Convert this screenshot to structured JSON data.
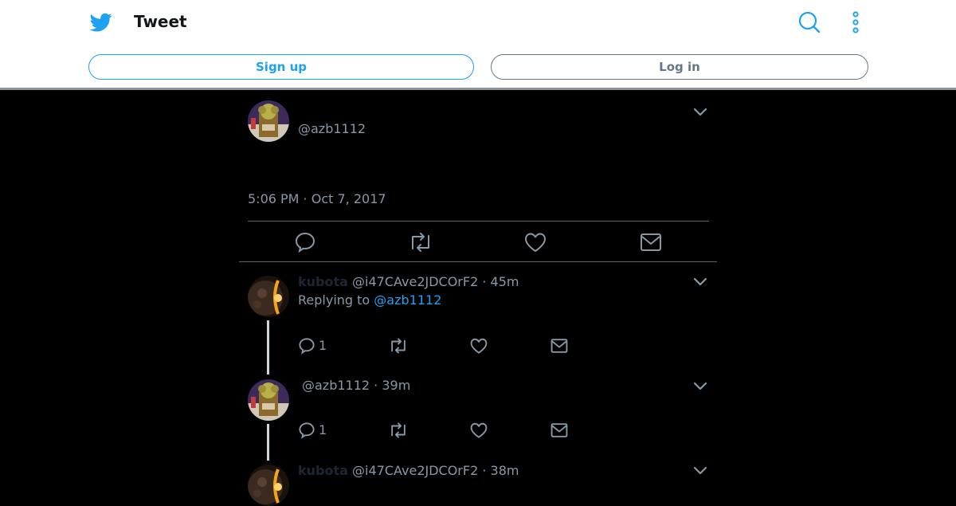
{
  "header": {
    "title": "Tweet",
    "signup_label": "Sign up",
    "login_label": "Log in"
  },
  "main_tweet": {
    "handle": "@azb1112",
    "timestamp": "5:06 PM · Oct 7, 2017"
  },
  "replies": [
    {
      "name": "kubota",
      "handle": "@i47CAve2JDCOrF2",
      "sep": " · ",
      "time": "45m",
      "replying_prefix": "Replying to ",
      "replying_to": "@azb1112",
      "reply_count": "1"
    },
    {
      "handle": "@azb1112",
      "sep": " · ",
      "time": "39m",
      "reply_count": "1"
    },
    {
      "name": "kubota",
      "handle": "@i47CAve2JDCOrF2",
      "sep": " · ",
      "time": "38m"
    }
  ],
  "colors": {
    "brand": "#1da1f2",
    "background": "#000000",
    "secondary_text": "#8899a6"
  },
  "icons": [
    "twitter-bird-icon",
    "search-icon",
    "more-vertical-icon",
    "chevron-down-icon",
    "reply-icon",
    "retweet-icon",
    "like-icon",
    "direct-message-icon"
  ]
}
